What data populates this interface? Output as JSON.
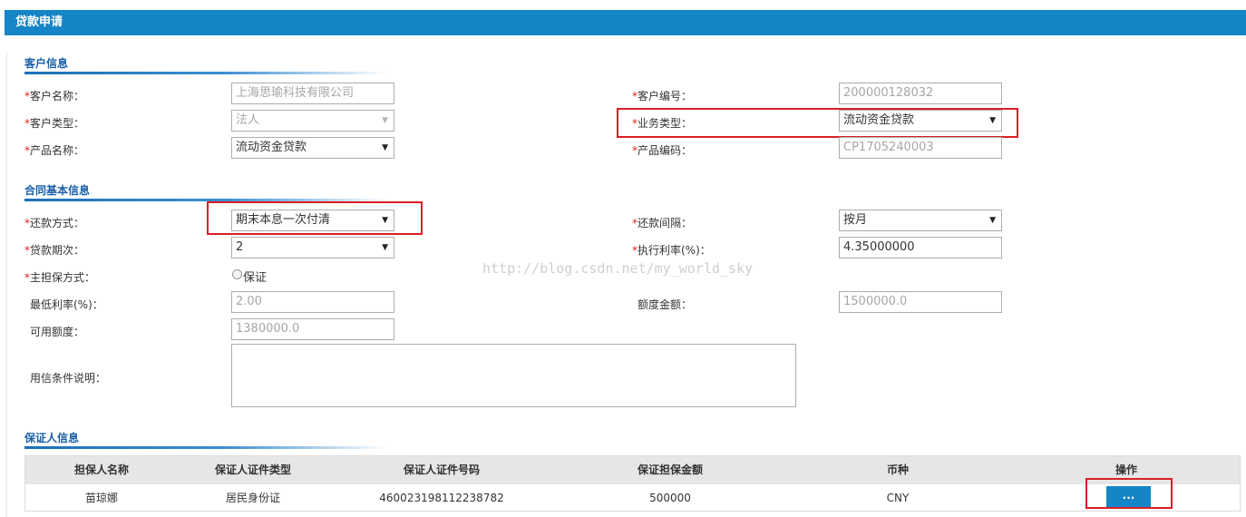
{
  "header": {
    "title": "贷款申请"
  },
  "watermark": "http://blog.csdn.net/my_world_sky",
  "sections": {
    "customer": "客户信息",
    "contract": "合同基本信息",
    "guarantor": "保证人信息"
  },
  "req_mark": "*",
  "customer": {
    "name_label": "客户名称：",
    "name_value": "上海思瑜科技有限公司",
    "code_label": "客户编号：",
    "code_value": "200000128032",
    "type_label": "客户类型：",
    "type_value": "法人",
    "biz_label": "业务类型：",
    "biz_value": "流动资金贷款",
    "product_label": "产品名称：",
    "product_value": "流动资金贷款",
    "product_code_label": "产品编码：",
    "product_code_value": "CP1705240003"
  },
  "contract": {
    "repay_label": "还款方式：",
    "repay_value": "期末本息一次付清",
    "interval_label": "还款间隔：",
    "interval_value": "按月",
    "periods_label": "贷款期次：",
    "periods_value": "2",
    "rate_label": "执行利率(%)：",
    "rate_value": "4.35000000",
    "guarantee_label": "主担保方式：",
    "guarantee_option": "保证",
    "min_rate_label": "最低利率(%)：",
    "min_rate_value": "2.00",
    "quota_label": "额度金额：",
    "quota_value": "1500000.0",
    "available_label": "可用额度：",
    "available_value": "1380000.0",
    "conditions_label": "用信条件说明：",
    "conditions_value": ""
  },
  "guarantor_table": {
    "columns": [
      "担保人名称",
      "保证人证件类型",
      "保证人证件号码",
      "保证担保金额",
      "币种",
      "操作"
    ],
    "rows": [
      {
        "name": "苗琼娜",
        "id_type": "居民身份证",
        "id_number": "460023198112238782",
        "amount": "500000",
        "currency": "CNY",
        "action": "..."
      }
    ]
  }
}
